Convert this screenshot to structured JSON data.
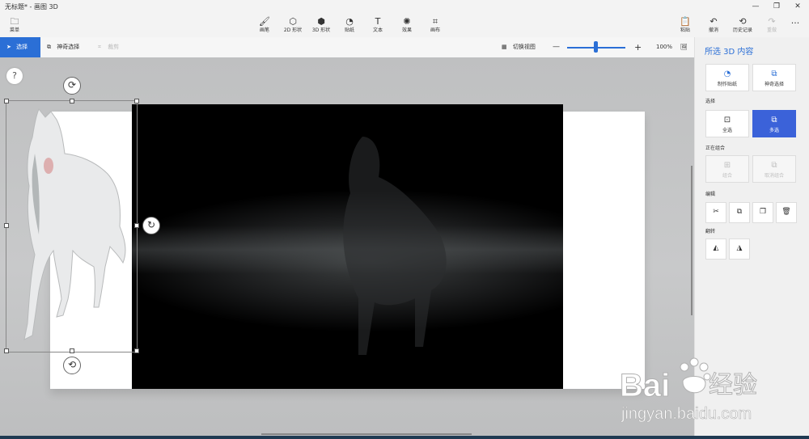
{
  "window": {
    "title": "无标题* - 画图 3D"
  },
  "ribbon": {
    "menu": "菜单",
    "tools": [
      {
        "label": "画笔",
        "icon": "brush-icon"
      },
      {
        "label": "2D 形状",
        "icon": "shapes-2d-icon"
      },
      {
        "label": "3D 形状",
        "icon": "shapes-3d-icon"
      },
      {
        "label": "贴纸",
        "icon": "sticker-icon"
      },
      {
        "label": "文本",
        "icon": "text-icon"
      },
      {
        "label": "效果",
        "icon": "effects-icon"
      },
      {
        "label": "画布",
        "icon": "canvas-icon"
      }
    ],
    "right": [
      {
        "label": "粘贴",
        "icon": "paste-icon"
      },
      {
        "label": "撤消",
        "icon": "undo-icon"
      },
      {
        "label": "历史记录",
        "icon": "history-icon"
      },
      {
        "label": "重做",
        "icon": "redo-icon"
      }
    ],
    "more": "···"
  },
  "toolbar": {
    "select": "选择",
    "magic_select": "神奇选择",
    "crop": "裁剪",
    "toggle_view": "切换视图",
    "zoom": "100%",
    "zoom_out": "—",
    "zoom_in": "+"
  },
  "panel": {
    "title": "所选 3D 内容",
    "make_sticker": "制作贴纸",
    "magic_select": "神奇选择",
    "section_select": "选择",
    "select_all": "全选",
    "multi_select": "多选",
    "section_group": "正在组合",
    "group": "组合",
    "ungroup": "取消组合",
    "section_edit": "编辑",
    "section_flip": "翻转"
  },
  "canvas": {
    "help": "?"
  },
  "watermark": {
    "brand": "Bai",
    "brand_cn": "经验",
    "url": "jingyan.baidu.com"
  },
  "colors": {
    "accent": "#2b6fd6",
    "active": "#3b62d9"
  }
}
